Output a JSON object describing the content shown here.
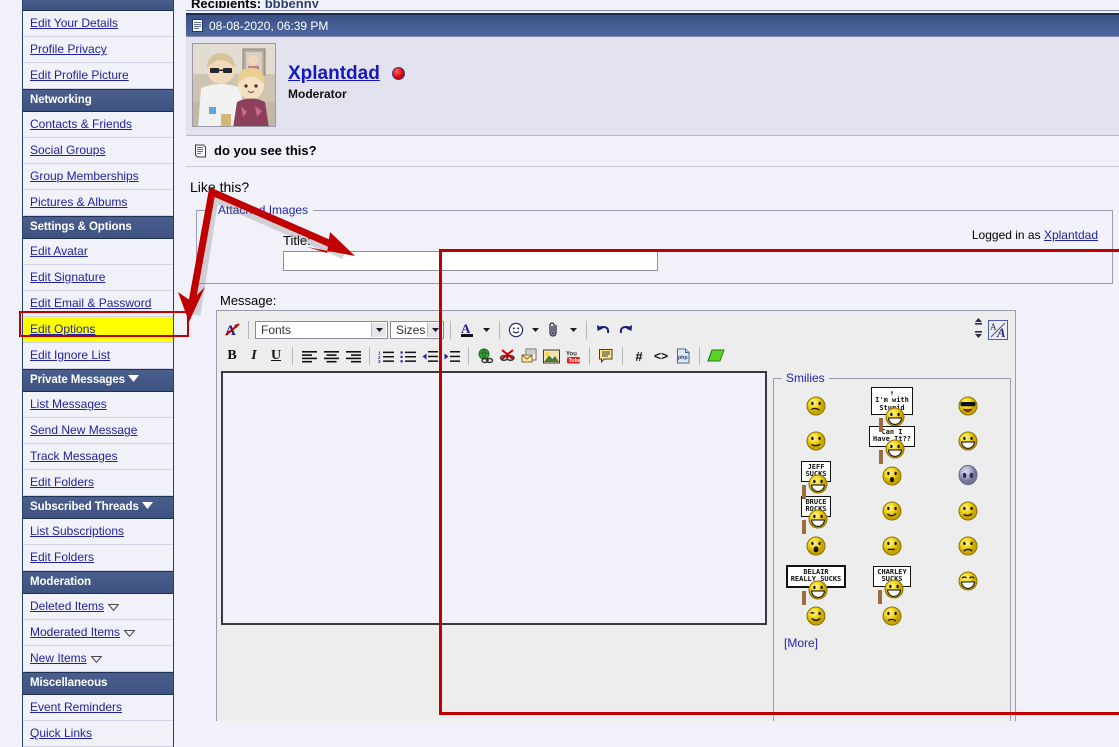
{
  "sidebar": {
    "sections": [
      {
        "type": "item",
        "label": "Edit Your Details"
      },
      {
        "type": "item",
        "label": "Profile Privacy"
      },
      {
        "type": "item",
        "label": "Edit Profile Picture"
      },
      {
        "type": "head",
        "label": "Networking"
      },
      {
        "type": "item",
        "label": "Contacts & Friends"
      },
      {
        "type": "item",
        "label": "Social Groups"
      },
      {
        "type": "item",
        "label": "Group Memberships"
      },
      {
        "type": "item",
        "label": "Pictures & Albums"
      },
      {
        "type": "head",
        "label": "Settings & Options"
      },
      {
        "type": "item",
        "label": "Edit Avatar"
      },
      {
        "type": "item",
        "label": "Edit Signature"
      },
      {
        "type": "item",
        "label": "Edit Email & Password"
      },
      {
        "type": "item",
        "label": "Edit Options",
        "highlighted": true
      },
      {
        "type": "item",
        "label": "Edit Ignore List"
      },
      {
        "type": "head",
        "label": "Private Messages",
        "caret": true
      },
      {
        "type": "item",
        "label": "List Messages"
      },
      {
        "type": "item",
        "label": "Send New Message"
      },
      {
        "type": "item",
        "label": "Track Messages"
      },
      {
        "type": "item",
        "label": "Edit Folders"
      },
      {
        "type": "head",
        "label": "Subscribed Threads",
        "caret": true
      },
      {
        "type": "item",
        "label": "List Subscriptions"
      },
      {
        "type": "item",
        "label": "Edit Folders"
      },
      {
        "type": "head",
        "label": "Moderation"
      },
      {
        "type": "item",
        "label": "Deleted Items",
        "ocaret": true
      },
      {
        "type": "item",
        "label": "Moderated Items",
        "ocaret": true
      },
      {
        "type": "item",
        "label": "New Items",
        "ocaret": true
      },
      {
        "type": "head",
        "label": "Miscellaneous"
      },
      {
        "type": "item",
        "label": "Event Reminders"
      },
      {
        "type": "item",
        "label": "Quick Links"
      }
    ]
  },
  "post": {
    "recipients_label": "Recipients",
    "recipients_value": "bbbenny",
    "date": "08-08-2020, 06:39 PM",
    "username": "Xplantdad",
    "usertitle": "Moderator",
    "subject": "do you see this?",
    "body": "Like  this?"
  },
  "attached": {
    "legend": "Attached Images",
    "title_label": "Title:",
    "title_value": "",
    "title_placeholder": ""
  },
  "session": {
    "logged_in_prefix": "Logged in as",
    "username": "Xplantdad"
  },
  "editor": {
    "message_label": "Message:",
    "message_value": "",
    "fonts_value": "Fonts",
    "sizes_value": "Sizes",
    "toolbar_row1": [
      {
        "name": "remove-formatting-icon",
        "glyph": "A"
      },
      {
        "name": "font-family-select",
        "glyph": "Fonts"
      },
      {
        "name": "font-size-select",
        "glyph": "Sizes"
      },
      {
        "name": "font-color-icon",
        "glyph": "A"
      },
      {
        "name": "smilie-icon",
        "glyph": "☺"
      },
      {
        "name": "attachment-icon",
        "glyph": "📎"
      },
      {
        "name": "undo-icon",
        "glyph": "↶"
      },
      {
        "name": "redo-icon",
        "glyph": "↷"
      }
    ],
    "toolbar_row2": [
      {
        "name": "bold-button",
        "glyph": "B"
      },
      {
        "name": "italic-button",
        "glyph": "I"
      },
      {
        "name": "underline-button",
        "glyph": "U"
      },
      {
        "name": "align-left-button",
        "glyph": "≡"
      },
      {
        "name": "align-center-button",
        "glyph": "≡"
      },
      {
        "name": "align-right-button",
        "glyph": "≡"
      },
      {
        "name": "ordered-list-button",
        "glyph": "1."
      },
      {
        "name": "unordered-list-button",
        "glyph": "•"
      },
      {
        "name": "outdent-button",
        "glyph": "⇤"
      },
      {
        "name": "indent-button",
        "glyph": "⇥"
      },
      {
        "name": "insert-link-button",
        "glyph": "🌐"
      },
      {
        "name": "remove-link-button",
        "glyph": "✖"
      },
      {
        "name": "insert-email-button",
        "glyph": "✉"
      },
      {
        "name": "insert-image-button",
        "glyph": "🖼"
      },
      {
        "name": "insert-video-button",
        "glyph": "You"
      },
      {
        "name": "insert-quote-button",
        "glyph": "❝"
      },
      {
        "name": "insert-hash-button",
        "glyph": "#"
      },
      {
        "name": "insert-code-button",
        "glyph": "<>"
      },
      {
        "name": "insert-php-button",
        "glyph": "php"
      },
      {
        "name": "highlight-button",
        "glyph": "◆"
      }
    ],
    "wysiwyg_toggle_label": "A",
    "resize_up_label": "▲",
    "resize_down_label": "▼"
  },
  "smilies": {
    "legend": "Smilies",
    "more_label": "[More]",
    "items": [
      {
        "name": "smilie-confused",
        "kind": "face",
        "face": "confused"
      },
      {
        "name": "smilie-im-with-stupid",
        "kind": "sign",
        "text": "↑\nI'm with\nStupid"
      },
      {
        "name": "smilie-cool",
        "kind": "face",
        "face": "cool"
      },
      {
        "name": "smilie-pray",
        "kind": "face",
        "face": "pray"
      },
      {
        "name": "smilie-can-i-have-it",
        "kind": "sign",
        "text": "Can I\nHave It??"
      },
      {
        "name": "smilie-grin",
        "kind": "face",
        "face": "grin"
      },
      {
        "name": "smilie-jeff-sucks",
        "kind": "sign",
        "text": "JEFF\nSUCKS"
      },
      {
        "name": "smilie-surprised",
        "kind": "face",
        "face": "surprised"
      },
      {
        "name": "smilie-grey-alien",
        "kind": "face",
        "face": "grey"
      },
      {
        "name": "smilie-bruce-rocks",
        "kind": "sign",
        "text": "BRUCE\nROCKS"
      },
      {
        "name": "smilie-flex",
        "kind": "face",
        "face": "flex"
      },
      {
        "name": "smilie-wave",
        "kind": "face",
        "face": "wave"
      },
      {
        "name": "smilie-shocked",
        "kind": "face",
        "face": "shocked"
      },
      {
        "name": "smilie-phone",
        "kind": "face",
        "face": "phone"
      },
      {
        "name": "smilie-sad",
        "kind": "face",
        "face": "sad"
      },
      {
        "name": "smilie-belair-really-sucks",
        "kind": "sign",
        "text": "BELAIR\nREALLY SUCKS",
        "thick": true
      },
      {
        "name": "smilie-charley-sucks",
        "kind": "sign",
        "text": "CHARLEY\nSUCKS"
      },
      {
        "name": "smilie-laugh",
        "kind": "face",
        "face": "laugh"
      },
      {
        "name": "smilie-wink",
        "kind": "face",
        "face": "wink"
      },
      {
        "name": "smilie-question",
        "kind": "face",
        "face": "question"
      }
    ]
  },
  "annotations": {
    "highlight_color": "#FFFF00",
    "box_color": "#C00000",
    "arrow_color": "#C00000"
  },
  "colors": {
    "page_bg": "#F1F1FA",
    "header_bar": "#4A5F8E",
    "link": "#22229C",
    "username_link": "#1616C8",
    "post_head_bg": "#E2E3EE"
  }
}
